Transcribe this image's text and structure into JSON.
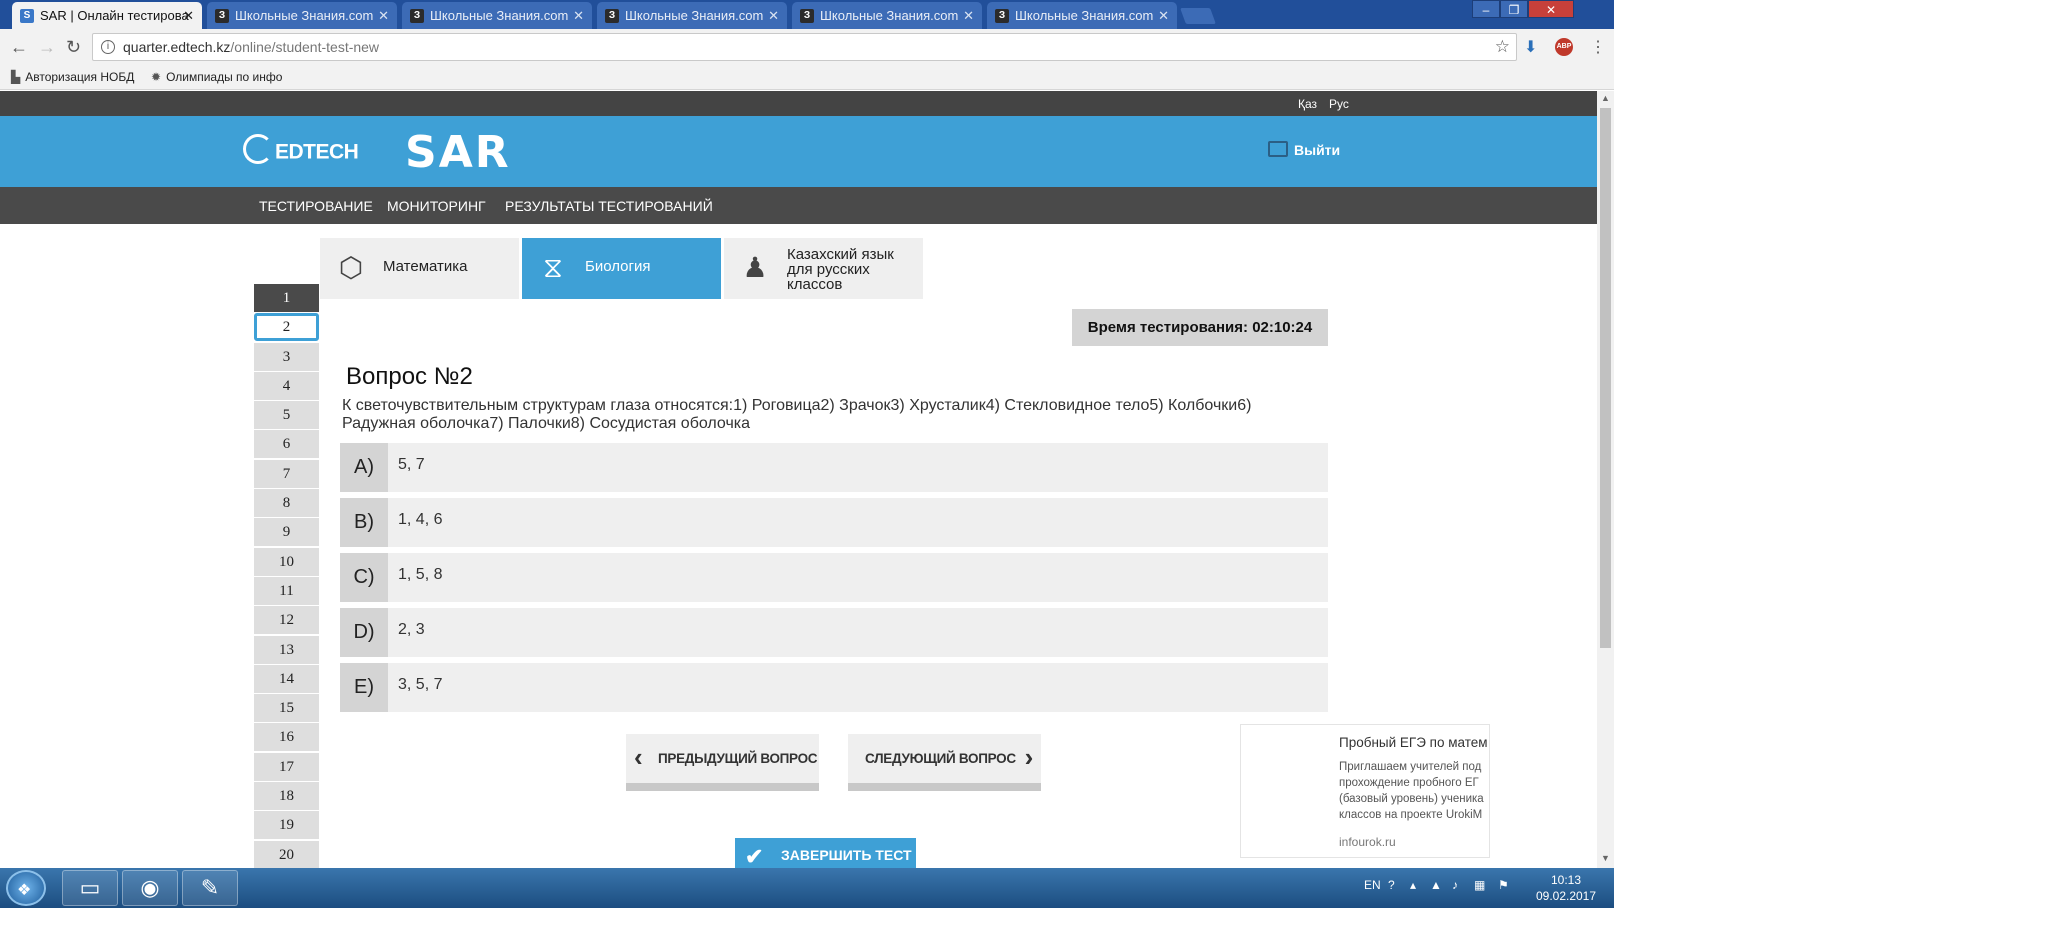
{
  "browser": {
    "tabs": [
      {
        "title": "SAR | Онлайн тестирова",
        "active": true,
        "fav": "S"
      },
      {
        "title": "Школьные Знания.com",
        "active": false,
        "fav": "З"
      },
      {
        "title": "Школьные Знания.com",
        "active": false,
        "fav": "З"
      },
      {
        "title": "Школьные Знания.com",
        "active": false,
        "fav": "З"
      },
      {
        "title": "Школьные Знания.com",
        "active": false,
        "fav": "З"
      },
      {
        "title": "Школьные Знания.com",
        "active": false,
        "fav": "З"
      }
    ],
    "url_host": "quarter.edtech.kz",
    "url_path": "/online/student-test-new",
    "abp_label": "ABP",
    "bookmarks": [
      {
        "label": "Авторизация НОБД",
        "icon": "bookmark-icon"
      },
      {
        "label": "Олимпиады по инфо",
        "icon": "sun-icon"
      }
    ]
  },
  "site": {
    "languages": [
      "Қаз",
      "Рус"
    ],
    "logo_edtech": "EDTECH",
    "logo_sar": "SAR",
    "logout_label": "Выйти",
    "menu": [
      "ТЕСТИРОВАНИЕ",
      "МОНИТОРИНГ",
      "РЕЗУЛЬТАТЫ ТЕСТИРОВАНИЙ"
    ],
    "subjects": [
      {
        "label": "Математика",
        "icon": "cube-icon",
        "active": false
      },
      {
        "label": "Биология",
        "icon": "dna-icon",
        "active": true
      },
      {
        "label": "Казахский язык для русских классов",
        "icon": "person-icon",
        "active": false
      }
    ],
    "question_numbers": [
      "1",
      "2",
      "3",
      "4",
      "5",
      "6",
      "7",
      "8",
      "9",
      "10",
      "11",
      "12",
      "13",
      "14",
      "15",
      "16",
      "17",
      "18",
      "19",
      "20"
    ],
    "current_question": 2,
    "timer": "Время тестирования: 02:10:24",
    "question_title": "Вопрос №2",
    "question_text": "К светочувствительным структурам глаза относятся:1) Роговица2) Зрачок3) Хрусталик4) Стекловидное тело5) Колбочки6) Радужная оболочка7) Палочки8) Сосудистая оболочка",
    "answers": [
      {
        "letter": "A)",
        "value": "5, 7"
      },
      {
        "letter": "B)",
        "value": "1, 4, 6"
      },
      {
        "letter": "C)",
        "value": "1, 5, 8"
      },
      {
        "letter": "D)",
        "value": "2, 3"
      },
      {
        "letter": "E)",
        "value": "3, 5, 7"
      }
    ],
    "prev_label": "ПРЕДЫДУЩИЙ ВОПРОС",
    "next_label": "СЛЕДУЮЩИЙ ВОПРОС",
    "finish_label": "ЗАВЕРШИТЬ ТЕСТ",
    "ad": {
      "title": "Пробный ЕГЭ по матем",
      "body_lines": [
        "Приглашаем учителей под",
        "прохождение пробного ЕГ",
        "(базовый уровень) ученика",
        "классов на проекте UrokiM"
      ],
      "source": "infourok.ru"
    }
  },
  "taskbar": {
    "lang": "EN",
    "time": "10:13",
    "date": "09.02.2017"
  },
  "colors": {
    "accent_blue": "#3ea0d6",
    "dark_bar": "#4a4a4a",
    "answer_bg": "#efefef"
  }
}
